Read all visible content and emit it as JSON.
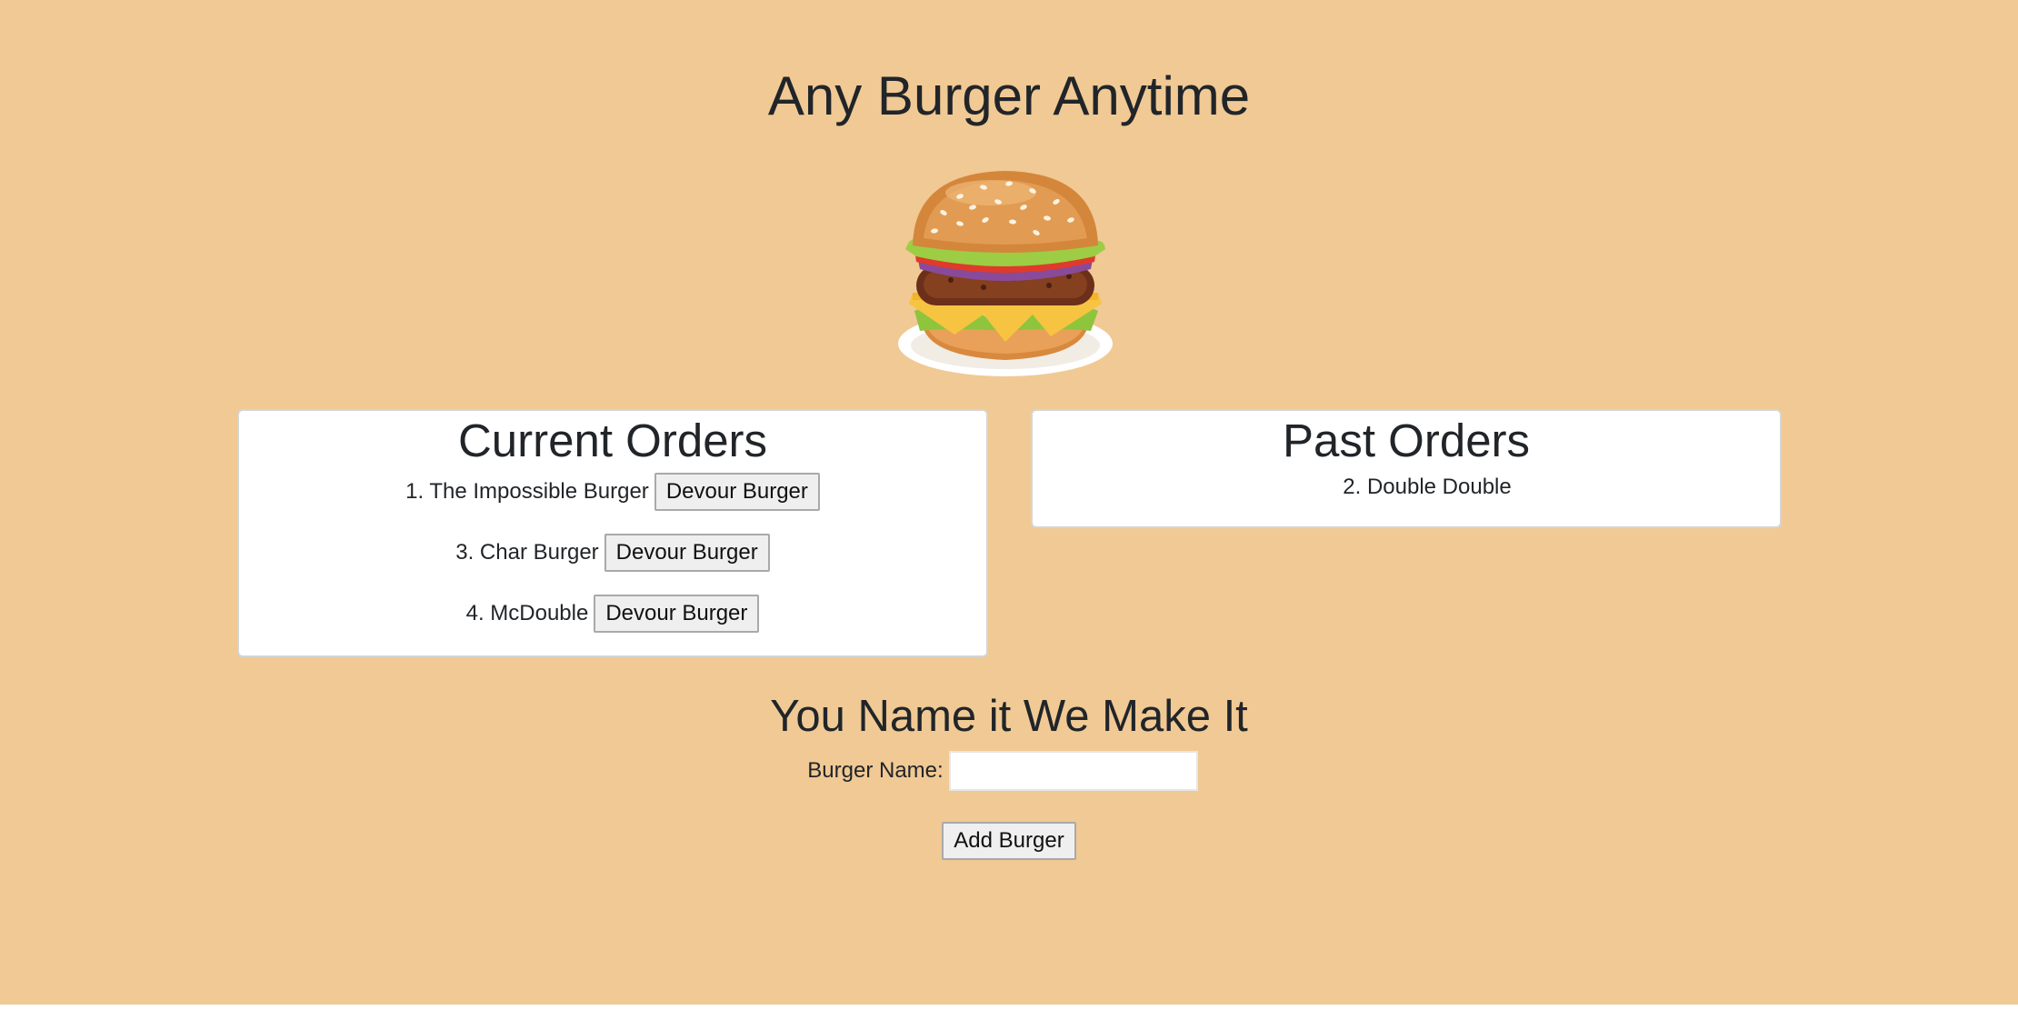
{
  "header": {
    "title": "Any Burger Anytime"
  },
  "hero": {
    "icon": "hamburger-illustration"
  },
  "current_orders": {
    "title": "Current Orders",
    "items": [
      {
        "label": "1. The Impossible Burger",
        "button_label": "Devour Burger"
      },
      {
        "label": "3. Char Burger",
        "button_label": "Devour Burger"
      },
      {
        "label": "4. McDouble",
        "button_label": "Devour Burger"
      }
    ]
  },
  "past_orders": {
    "title": "Past Orders",
    "items": [
      {
        "label": "2. Double Double"
      }
    ]
  },
  "form": {
    "title": "You Name it We Make It",
    "field_label": "Burger Name:",
    "field_value": "",
    "submit_label": "Add Burger"
  },
  "colors": {
    "page_background": "#f0c994",
    "card_background": "#ffffff",
    "text": "#212529",
    "button_background": "#efefef"
  }
}
